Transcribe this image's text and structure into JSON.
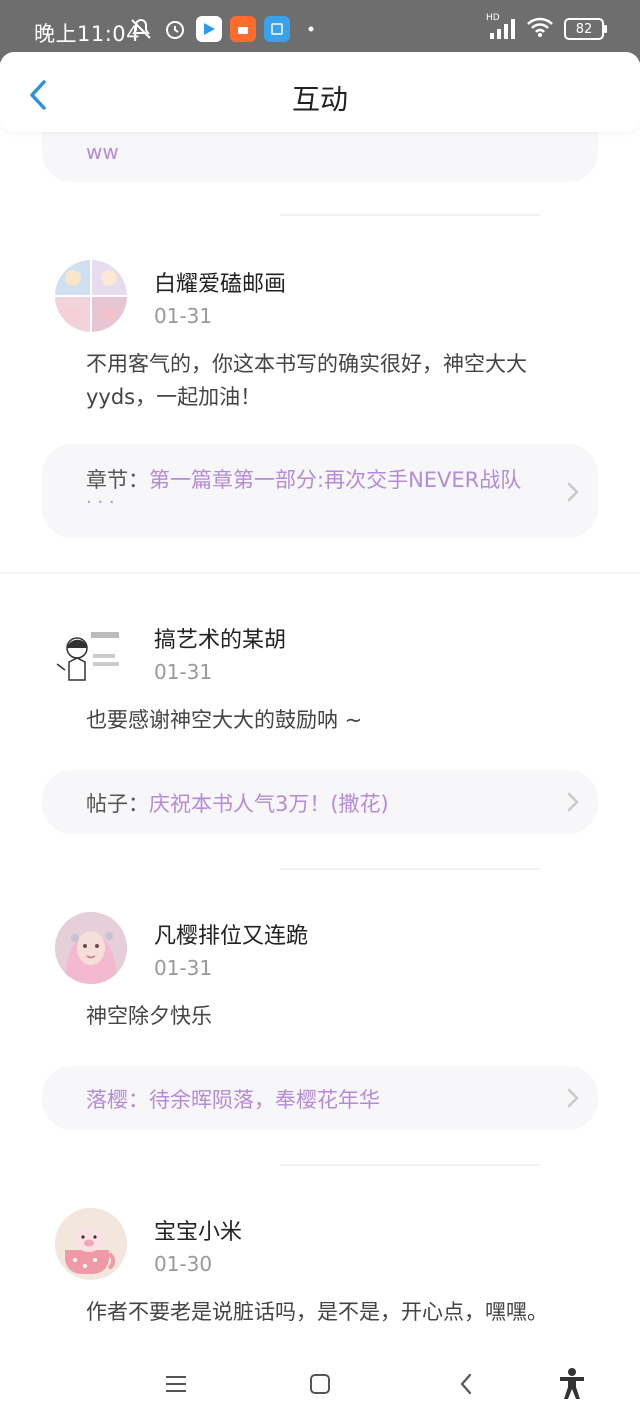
{
  "status": {
    "time": "晚上11:04",
    "network": "HD",
    "battery": "82"
  },
  "header": {
    "title": "互动"
  },
  "top_snippet": "ww",
  "items": [
    {
      "user": "白耀爱磕邮画",
      "date": "01-31",
      "comment_line1": "不用客气的，你这本书写的确实很好，神空大大",
      "comment_line2": "yyds，一起加油！",
      "ref_label": "章节：",
      "ref_text": "第一篇章第一部分:再次交手NEVER战队",
      "ref_more": "· · ·"
    },
    {
      "user": "搞艺术的某胡",
      "date": "01-31",
      "comment_line1": "也要感谢神空大大的鼓励呐 ~",
      "ref_label": "帖子：",
      "ref_text": "庆祝本书人气3万！(撒花)"
    },
    {
      "user": "凡樱排位又连跪",
      "date": "01-31",
      "comment_line1": "神空除夕快乐",
      "ref_text": "落樱：待余晖陨落，奉樱花年华"
    },
    {
      "user": "宝宝小米",
      "date": "01-30",
      "comment_line1": "作者不要老是说脏话吗，是不是，开心点，嘿嘿。"
    }
  ],
  "colors": {
    "link": "#b58ad6",
    "back_arrow": "#2f8fe0"
  }
}
